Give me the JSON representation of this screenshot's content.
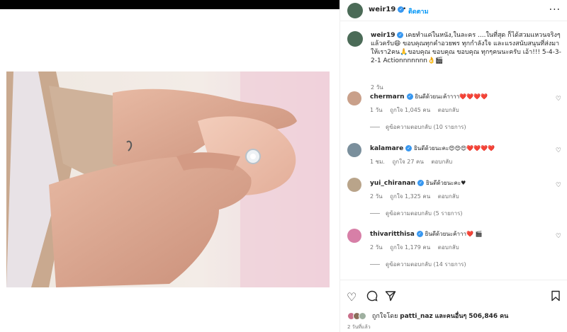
{
  "post": {
    "username": "weir19",
    "follow_label": "ติดตาม",
    "caption": "เคยทำแค่ในหนัง,ในละคร ....ในที่สุด ก็ได้สวมแหวนจริงๆแล้วครับ😄 ขอบคุณทุกคำอวยพร ทุกกำลังใจ และแรงสนับสนุนที่ส่งมาให้เรา2คน🙏ขอบคุณ ขอบคุณ ขอบคุณ ทุกๆคนนะครับ เอ้า!!! 5-4-3-2-1 Actionnnnnnn👌🎬",
    "caption_age": "2 วัน"
  },
  "comments": [
    {
      "username": "chermarn",
      "text": "ยินดีด้วยนะค้าาาา❤️❤️❤️❤️",
      "age": "1 วัน",
      "likes": "ถูกใจ 1,045 คน",
      "reply_label": "ตอบกลับ",
      "view_replies": "ดูข้อความตอบกลับ (10 รายการ)",
      "avatar_color": "#c9a08a"
    },
    {
      "username": "kalamare",
      "text": "ยินดีด้วยนะคะ😍😍😍❤️❤️❤️❤️",
      "age": "1 ชม.",
      "likes": "ถูกใจ 27 คน",
      "reply_label": "ตอบกลับ",
      "view_replies": "",
      "avatar_color": "#7a8f9c"
    },
    {
      "username": "yui_chiranan",
      "text": "ยินดีด้วยนะคะ♥",
      "age": "2 วัน",
      "likes": "ถูกใจ 1,325 คน",
      "reply_label": "ตอบกลับ",
      "view_replies": "ดูข้อความตอบกลับ (5 รายการ)",
      "avatar_color": "#b9a48a"
    },
    {
      "username": "thivaritthisa",
      "text": "ยินดีด้วยนะค้าาา❤️ 🎬",
      "age": "2 วัน",
      "likes": "ถูกใจ 1,179 คน",
      "reply_label": "ตอบกลับ",
      "view_replies": "ดูข้อความตอบกลับ (14 รายการ)",
      "avatar_color": "#d77fa7"
    }
  ],
  "footer": {
    "liked_by_prefix": "ถูกใจโดย",
    "liked_by_user": "patti_naz",
    "liked_by_and": "และคนอื่นๆ",
    "liked_by_count": "506,846",
    "liked_by_suffix": "คน",
    "time_ago": "2 วันที่แล้ว"
  },
  "icons": {
    "like": "heart-icon",
    "comment": "comment-icon",
    "share": "share-icon",
    "save": "bookmark-icon",
    "more": "more-icon"
  },
  "colors": {
    "link_blue": "#0095f6",
    "verified_blue": "#3797f0",
    "muted_text": "#737373"
  }
}
